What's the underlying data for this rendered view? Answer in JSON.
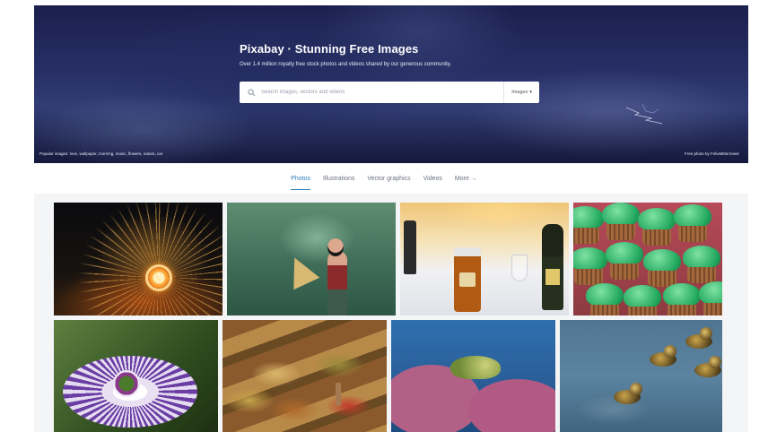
{
  "hero": {
    "title": "Pixabay · Stunning Free Images",
    "subtitle": "Over 1.4 million royalty free stock photos and videos shared by our generous community.",
    "popular": "Popular images: love, wallpaper, morning, music, flowers, nature, car",
    "credit": "Free photo by FelixMittermeier"
  },
  "search": {
    "placeholder": "Search images, vectors and videos",
    "type_label": "Images",
    "type_caret": "▾"
  },
  "tabs": [
    {
      "label": "Photos",
      "active": true
    },
    {
      "label": "Illustrations",
      "active": false
    },
    {
      "label": "Vector graphics",
      "active": false
    },
    {
      "label": "Videos",
      "active": false
    },
    {
      "label": "More →",
      "active": false
    }
  ],
  "colors": {
    "accent": "#2e7fbf",
    "tab_text": "#6b7280",
    "gallery_bg": "#f4f5f7"
  },
  "icons": {
    "search": "search-icon",
    "caret": "chevron-down-icon"
  }
}
